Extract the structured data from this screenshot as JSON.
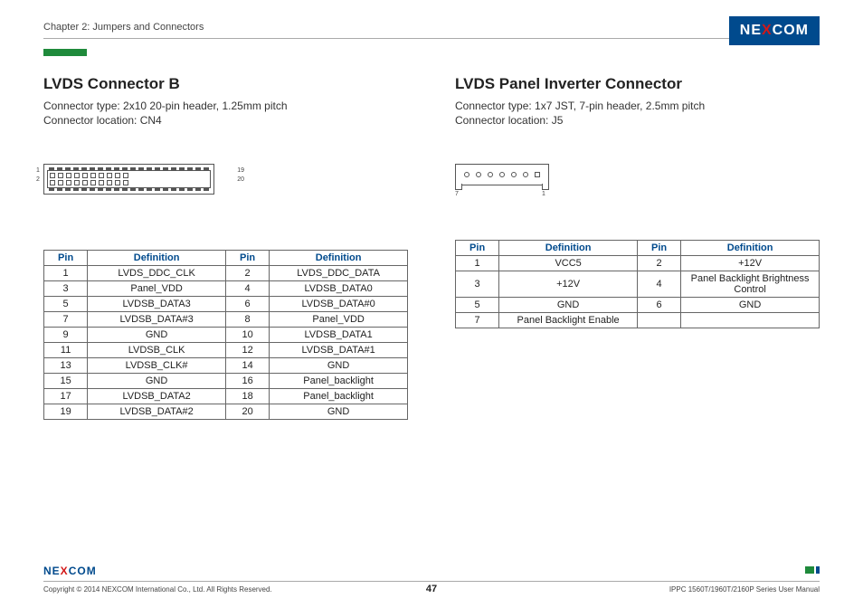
{
  "chapter": "Chapter 2: Jumpers and Connectors",
  "logo": {
    "part1": "NE",
    "x": "X",
    "part2": "COM"
  },
  "left": {
    "title": "LVDS Connector B",
    "line1": "Connector type: 2x10 20-pin header, 1.25mm pitch",
    "line2": "Connector location: CN4",
    "labels": {
      "tl": "1",
      "bl": "2",
      "tr": "19",
      "br": "20"
    },
    "headers": {
      "pin1": "Pin",
      "def1": "Definition",
      "pin2": "Pin",
      "def2": "Definition"
    },
    "rows": [
      {
        "p1": "1",
        "d1": "LVDS_DDC_CLK",
        "p2": "2",
        "d2": "LVDS_DDC_DATA"
      },
      {
        "p1": "3",
        "d1": "Panel_VDD",
        "p2": "4",
        "d2": "LVDSB_DATA0"
      },
      {
        "p1": "5",
        "d1": "LVDSB_DATA3",
        "p2": "6",
        "d2": "LVDSB_DATA#0"
      },
      {
        "p1": "7",
        "d1": "LVDSB_DATA#3",
        "p2": "8",
        "d2": "Panel_VDD"
      },
      {
        "p1": "9",
        "d1": "GND",
        "p2": "10",
        "d2": "LVDSB_DATA1"
      },
      {
        "p1": "11",
        "d1": "LVDSB_CLK",
        "p2": "12",
        "d2": "LVDSB_DATA#1"
      },
      {
        "p1": "13",
        "d1": "LVDSB_CLK#",
        "p2": "14",
        "d2": "GND"
      },
      {
        "p1": "15",
        "d1": "GND",
        "p2": "16",
        "d2": "Panel_backlight"
      },
      {
        "p1": "17",
        "d1": "LVDSB_DATA2",
        "p2": "18",
        "d2": "Panel_backlight"
      },
      {
        "p1": "19",
        "d1": "LVDSB_DATA#2",
        "p2": "20",
        "d2": "GND"
      }
    ]
  },
  "right": {
    "title": "LVDS Panel Inverter Connector",
    "line1": "Connector type: 1x7 JST, 7-pin header, 2.5mm pitch",
    "line2": "Connector location: J5",
    "labels": {
      "l": "7",
      "r": "1"
    },
    "headers": {
      "pin1": "Pin",
      "def1": "Definition",
      "pin2": "Pin",
      "def2": "Definition"
    },
    "rows": [
      {
        "p1": "1",
        "d1": "VCC5",
        "p2": "2",
        "d2": "+12V"
      },
      {
        "p1": "3",
        "d1": "+12V",
        "p2": "4",
        "d2": "Panel Backlight Brightness Control"
      },
      {
        "p1": "5",
        "d1": "GND",
        "p2": "6",
        "d2": "GND"
      },
      {
        "p1": "7",
        "d1": "Panel Backlight Enable",
        "p2": "",
        "d2": ""
      }
    ]
  },
  "footer": {
    "logo": {
      "part1": "NE",
      "x": "X",
      "part2": "COM"
    },
    "copyright": "Copyright © 2014 NEXCOM International Co., Ltd. All Rights Reserved.",
    "page": "47",
    "manual": "IPPC 1560T/1960T/2160P Series User Manual"
  }
}
